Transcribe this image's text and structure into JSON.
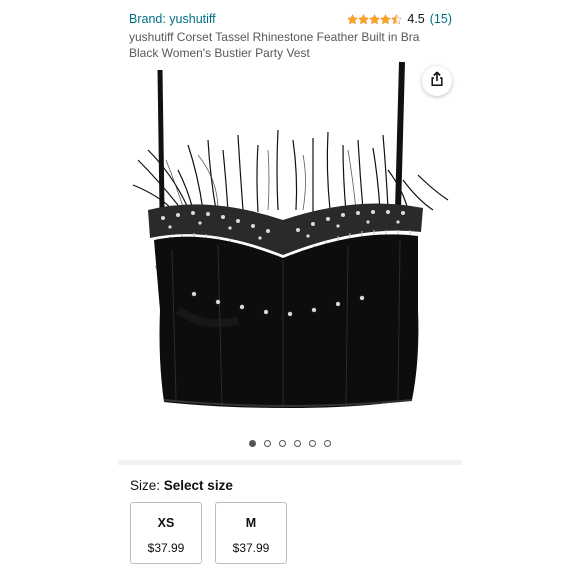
{
  "header": {
    "brand_link": "Brand: yushutiff",
    "rating_value": "4.5",
    "rating_count": "(15)",
    "rating_stars": 4.5,
    "title": "yushutiff Corset Tassel Rhinestone Feather Built in Bra Black Women's Bustier Party Vest"
  },
  "gallery": {
    "image_count": 6,
    "active_index": 0,
    "share_icon": "share-icon"
  },
  "size": {
    "label_prefix": "Size:",
    "label_value": "Select size",
    "options": [
      {
        "code": "XS",
        "price": "$37.99"
      },
      {
        "code": "M",
        "price": "$37.99"
      }
    ]
  },
  "colors": {
    "link": "#007185",
    "star": "#ffa41c",
    "text": "#0f1111"
  }
}
